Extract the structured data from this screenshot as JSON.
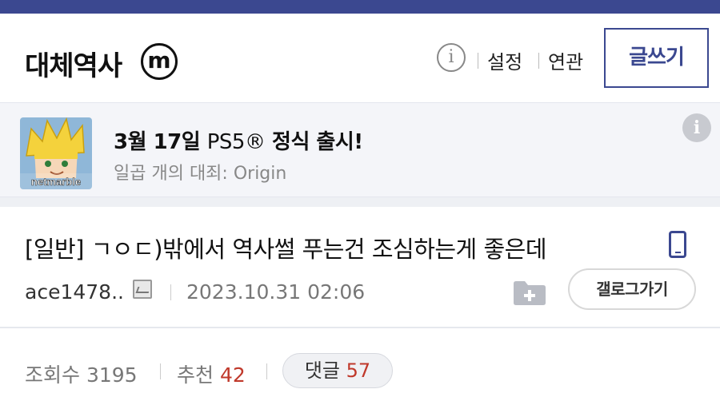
{
  "header": {
    "gallery_title": "대체역사",
    "minor_badge": "m",
    "info_icon": "info-icon",
    "settings_label": "설정",
    "related_label": "연관",
    "write_button_label": "글쓰기",
    "accent_color": "#3b4890"
  },
  "ad": {
    "headline_prefix": "3월 17일",
    "headline_platform": "PS5®",
    "headline_suffix": "정식 출시!",
    "subtitle": "일곱 개의 대죄: Origin",
    "thumb_brand": "netmarble",
    "info_icon": "info-icon"
  },
  "post": {
    "title": "[일반] ㄱㅇㄷ)밖에서 역사썰 푸는건 조심하는게 좋은데",
    "device_icon": "mobile-icon",
    "author": "ace1478..",
    "author_icon": "fixed-nickname-icon",
    "date": "2023.10.31 02:06",
    "add_icon": "add-folder-icon",
    "gallery_go_label": "갤로그가기"
  },
  "stats": {
    "views_label": "조회수",
    "views_value": "3195",
    "recommend_label": "추천",
    "recommend_value": "42",
    "comments_label": "댓글",
    "comments_value": "57"
  }
}
